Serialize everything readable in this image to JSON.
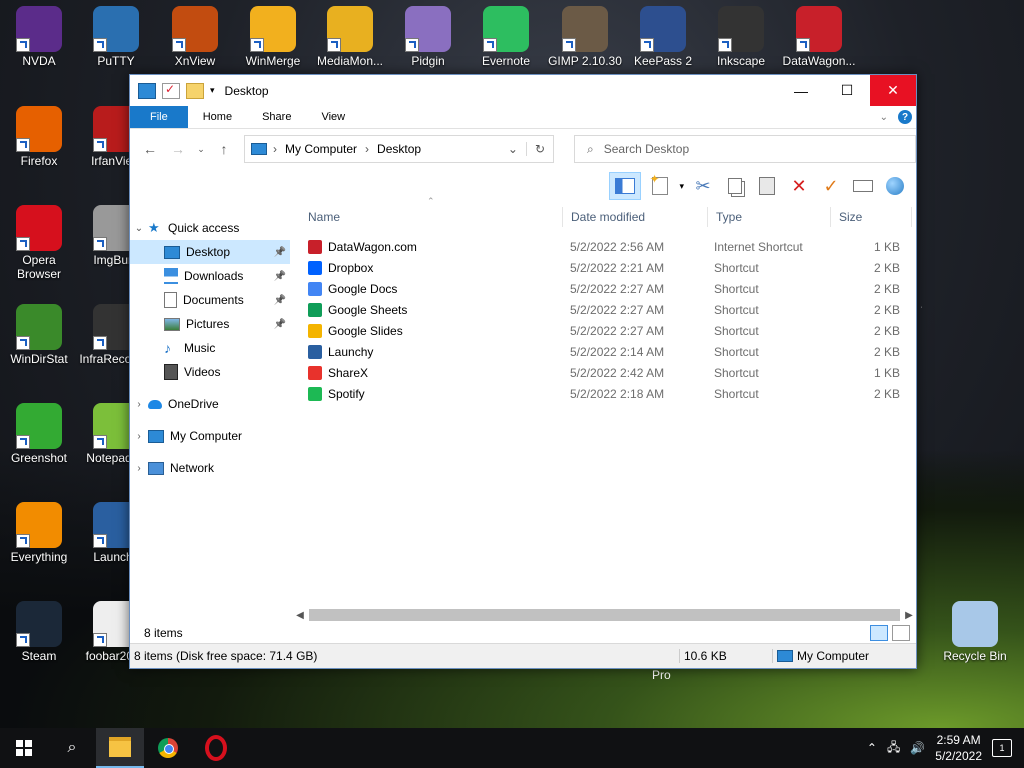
{
  "desktop": {
    "icons": [
      {
        "label": "NVDA",
        "color": "#5b2c8a"
      },
      {
        "label": "PuTTY",
        "color": "#2a6fb0"
      },
      {
        "label": "XnView",
        "color": "#c24c10"
      },
      {
        "label": "WinMerge",
        "color": "#f2b01e"
      },
      {
        "label": "MediaMon...",
        "color": "#e8b020"
      },
      {
        "label": "Pidgin",
        "color": "#8a6fc0"
      },
      {
        "label": "Evernote",
        "color": "#2dbe60"
      },
      {
        "label": "GIMP 2.10.30",
        "color": "#6b5a46"
      },
      {
        "label": "KeePass 2",
        "color": "#2d4f8f"
      },
      {
        "label": "Inkscape",
        "color": "#333333"
      },
      {
        "label": "DataWagon...",
        "color": "#c8202a"
      },
      {
        "label": "Firefox",
        "color": "#e66000"
      },
      {
        "label": "IrfanView",
        "color": "#b81c1c"
      },
      {
        "label": "Opera Browser",
        "color": "#d6101d"
      },
      {
        "label": "ImgBurn",
        "color": "#999999"
      },
      {
        "label": "WinDirStat",
        "color": "#3a8a2a"
      },
      {
        "label": "InfraRecorder",
        "color": "#333333"
      },
      {
        "label": "Greenshot",
        "color": "#33aa33"
      },
      {
        "label": "Notepad++",
        "color": "#7cbf3a"
      },
      {
        "label": "Everything",
        "color": "#f28c00"
      },
      {
        "label": "Launchy",
        "color": "#2a5fa0"
      },
      {
        "label": "Steam",
        "color": "#1b2838"
      },
      {
        "label": "foobar2000",
        "color": "#eeeeee"
      },
      {
        "label": "Recycle Bin",
        "color": "#a8c8e8"
      }
    ],
    "pro_text": "Pro"
  },
  "window": {
    "title": "Desktop",
    "ribbon_tabs": [
      "File",
      "Home",
      "Share",
      "View"
    ],
    "address": {
      "root": "My Computer",
      "current": "Desktop"
    },
    "search_placeholder": "Search Desktop",
    "nav": {
      "quick_access": "Quick access",
      "items": [
        "Desktop",
        "Downloads",
        "Documents",
        "Pictures",
        "Music",
        "Videos"
      ],
      "onedrive": "OneDrive",
      "my_computer": "My Computer",
      "network": "Network"
    },
    "columns": {
      "name": "Name",
      "date": "Date modified",
      "type": "Type",
      "size": "Size"
    },
    "files": [
      {
        "name": "DataWagon.com",
        "date": "5/2/2022 2:56 AM",
        "type": "Internet Shortcut",
        "size": "1 KB",
        "color": "#c8202a"
      },
      {
        "name": "Dropbox",
        "date": "5/2/2022 2:21 AM",
        "type": "Shortcut",
        "size": "2 KB",
        "color": "#0061fe"
      },
      {
        "name": "Google Docs",
        "date": "5/2/2022 2:27 AM",
        "type": "Shortcut",
        "size": "2 KB",
        "color": "#4285f4"
      },
      {
        "name": "Google Sheets",
        "date": "5/2/2022 2:27 AM",
        "type": "Shortcut",
        "size": "2 KB",
        "color": "#0f9d58"
      },
      {
        "name": "Google Slides",
        "date": "5/2/2022 2:27 AM",
        "type": "Shortcut",
        "size": "2 KB",
        "color": "#f4b400"
      },
      {
        "name": "Launchy",
        "date": "5/2/2022 2:14 AM",
        "type": "Shortcut",
        "size": "2 KB",
        "color": "#2a5fa0"
      },
      {
        "name": "ShareX",
        "date": "5/2/2022 2:42 AM",
        "type": "Shortcut",
        "size": "1 KB",
        "color": "#e8322c"
      },
      {
        "name": "Spotify",
        "date": "5/2/2022 2:18 AM",
        "type": "Shortcut",
        "size": "2 KB",
        "color": "#1db954"
      }
    ],
    "item_count": "8 items",
    "status_detail": "8 items (Disk free space: 71.4 GB)",
    "status_size": "10.6 KB",
    "status_location": "My Computer"
  },
  "taskbar": {
    "time": "2:59 AM",
    "date": "5/2/2022",
    "notifications": "1"
  }
}
